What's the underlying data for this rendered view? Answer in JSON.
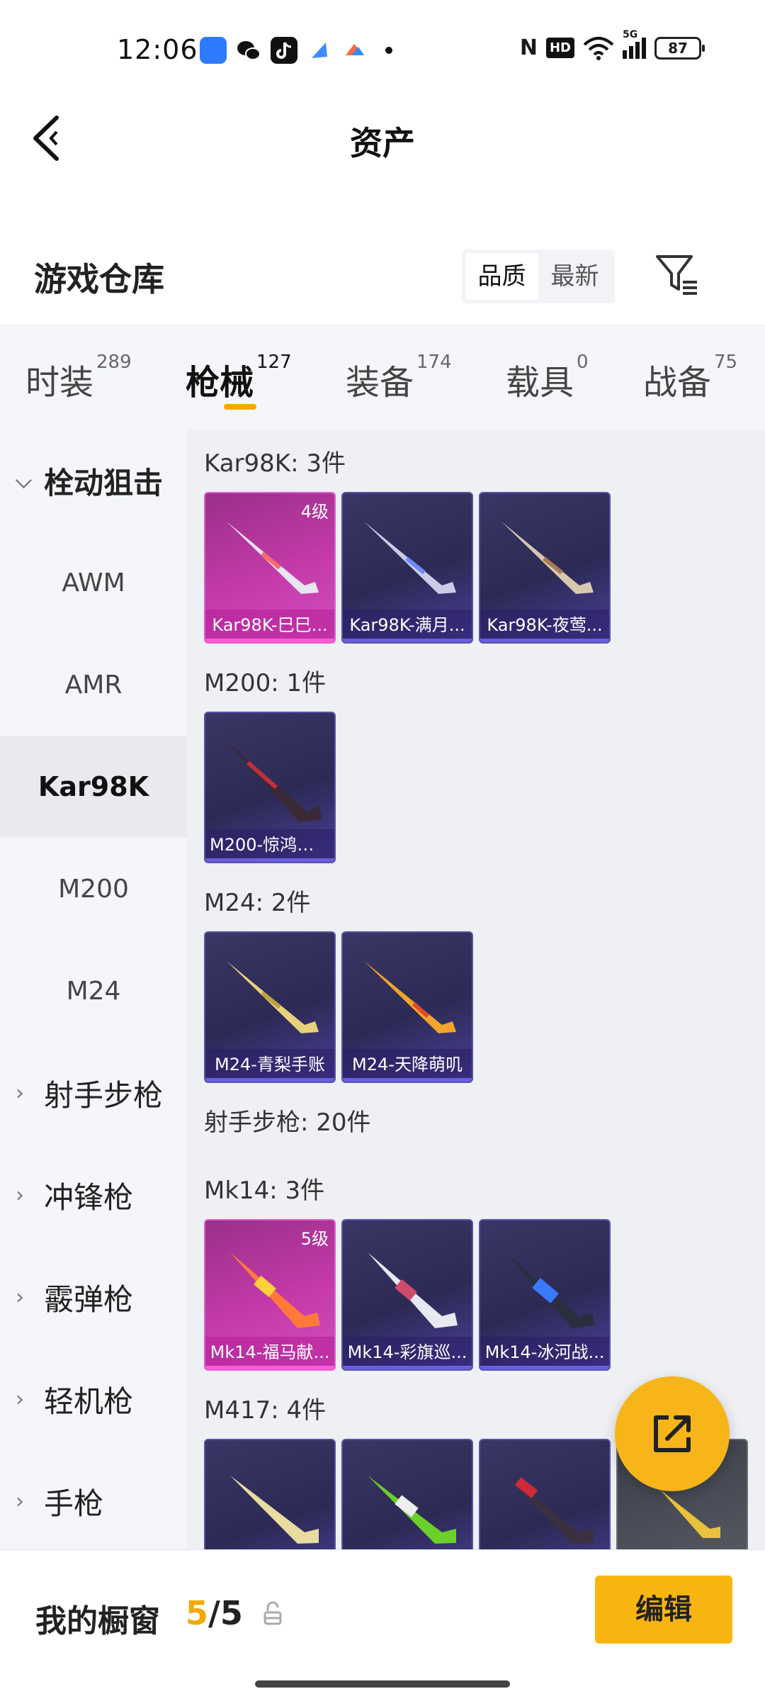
{
  "status_bar": {
    "time": "12:06",
    "battery": "87",
    "network": "5G",
    "hd_label": "HD",
    "nfc_label": "N"
  },
  "header": {
    "title": "资产"
  },
  "repository": {
    "title": "游戏仓库",
    "sort_options": [
      "品质",
      "最新"
    ],
    "active_sort": "品质"
  },
  "tabs": [
    {
      "label": "时装",
      "count": "289"
    },
    {
      "label": "枪械",
      "count": "127"
    },
    {
      "label": "装备",
      "count": "174"
    },
    {
      "label": "载具",
      "count": "0"
    },
    {
      "label": "战备",
      "count": "75"
    }
  ],
  "sidenav": {
    "category_open": "栓动狙击",
    "sub_items": [
      "AWM",
      "AMR",
      "Kar98K",
      "M200",
      "M24"
    ],
    "active_sub": "Kar98K",
    "categories": [
      "射手步枪",
      "冲锋枪",
      "霰弹枪",
      "轻机枪",
      "手枪"
    ]
  },
  "content": {
    "groups": [
      {
        "title": "Kar98K: 3件",
        "items": [
          {
            "name": "Kar98K-巳巳...",
            "level": "4级",
            "quality": "pink"
          },
          {
            "name": "Kar98K-满月...",
            "level": "",
            "quality": "purple"
          },
          {
            "name": "Kar98K-夜莺...",
            "level": "",
            "quality": "purple"
          }
        ]
      },
      {
        "title": "M200: 1件",
        "items": [
          {
            "name": "M200-惊鸿侠...",
            "level": "",
            "quality": "purple"
          }
        ]
      },
      {
        "title": "M24: 2件",
        "items": [
          {
            "name": "M24-青梨手账",
            "level": "",
            "quality": "purple"
          },
          {
            "name": "M24-天降萌叽",
            "level": "",
            "quality": "purple"
          }
        ]
      },
      {
        "title": "射手步枪: 20件",
        "items": []
      },
      {
        "title": "Mk14: 3件",
        "items": [
          {
            "name": "Mk14-福马献...",
            "level": "5级",
            "quality": "pink"
          },
          {
            "name": "Mk14-彩旗巡...",
            "level": "",
            "quality": "purple"
          },
          {
            "name": "Mk14-冰河战...",
            "level": "",
            "quality": "purple"
          }
        ]
      },
      {
        "title": "M417: 4件",
        "items": [
          {
            "name": "",
            "level": "",
            "quality": "purple"
          },
          {
            "name": "",
            "level": "",
            "quality": "purple"
          },
          {
            "name": "",
            "level": "",
            "quality": "purple"
          },
          {
            "name": "",
            "level": "",
            "quality": "grey"
          }
        ]
      }
    ]
  },
  "bottom_bar": {
    "label": "我的橱窗",
    "count_current": "5",
    "count_separator": "/",
    "count_total": "5",
    "edit_label": "编辑"
  },
  "colors": {
    "accent": "#f5a800",
    "pink_quality": "#c43aa8",
    "purple_quality": "#3a3665"
  }
}
